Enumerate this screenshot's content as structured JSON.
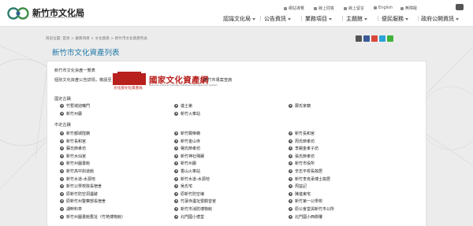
{
  "header": {
    "logo_title": "新竹市文化局",
    "logo_subtitle": "Cultural Affairs Bureau, Hsinchu City",
    "utilities": [
      {
        "icon": "home-icon",
        "label": "網站導覽"
      },
      {
        "icon": "question-icon",
        "label": "線上問答"
      },
      {
        "icon": "chat-icon",
        "label": "線上留言"
      },
      {
        "icon": "globe-icon",
        "label": "English"
      },
      {
        "icon": "accessibility-icon",
        "label": "無障礙"
      }
    ],
    "search_icon": "search-icon",
    "nav": [
      "認識文化局",
      "公告資訊",
      "業務項目",
      "主題館",
      "便民服務",
      "政府公開資訊"
    ]
  },
  "breadcrumb": "目前位置: 首頁 > 業務項目 > 文化資產 > 新竹市文化資產列表",
  "share_icons": [
    "print-icon",
    "facebook-icon",
    "plurk-icon",
    "twitter-icon",
    "line-icon"
  ],
  "colors": {
    "accent": "#1f79a8",
    "brand_red": "#b8201e",
    "bullet": "#555555"
  },
  "page_title": "新竹市文化資產列表",
  "content": {
    "intro": "新竹市文化資產一覽表",
    "link_prefix": "個別文化資產公告詳情，敬請至",
    "banner_caption": "文化部文化資產局",
    "banner_title": "國家文化資產網",
    "banner_sub": "National Cultural Heritage Database Management System",
    "link_suffix": "新竹市專案查詢",
    "national_heading": "國定古蹟",
    "national": [
      "竹塹城迎曦門",
      "鄭氏家廟",
      "新竹州廳",
      "進士第",
      "新竹火車站"
    ],
    "city_heading": "市定古蹟",
    "city": [
      [
        "新竹都城隍廟",
        "新竹關帝廟",
        "新竹長和宮"
      ],
      [
        "新竹長和宮",
        "新竹金山寺",
        "周氏節孝坊"
      ],
      [
        "蘇氏節孝坊",
        "楊氏節孝坊",
        "李錫金孝子坊"
      ],
      [
        "新竹水仙宮",
        "新竹神社殘蹟",
        "張氏節孝坊"
      ],
      [
        "新竹州圖書館",
        "新竹州廳",
        "新竹市役所"
      ],
      [
        "新竹高中劍道館",
        "香山火車站",
        "辛志平校長故居"
      ],
      [
        "新竹水道-水源地",
        "新竹水道-水源地",
        "新竹李克承博士故居"
      ],
      [
        "新竹公學校院長宿舍",
        "吳氏宅",
        "周益記"
      ],
      [
        "原新竹防空洞遺跡",
        "原新竹防空壕",
        "陳進東宅"
      ],
      [
        "原新竹州警察部長宿舍",
        "竹蓮寺遺址暨觀音宮",
        "新竹第一公學校"
      ],
      [
        "湖畔料亭",
        "新竹市消防博物館",
        "原公會堂與新竹市公所"
      ],
      [
        "新竹州圖書館舊址（竹苑博物館）",
        "北門國小禮堂",
        "北門國小西側樓"
      ]
    ]
  }
}
